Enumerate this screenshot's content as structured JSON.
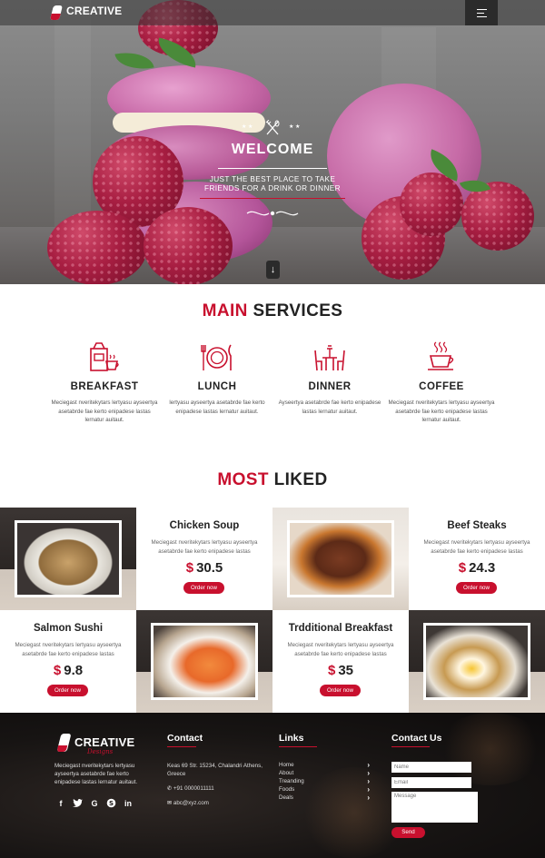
{
  "header": {
    "logo_text": "CREATIVE",
    "menu_icon": "hamburger-icon"
  },
  "hero": {
    "title": "WELCOME",
    "subtitle": "JUST THE BEST PLACE TO TAKE FRIENDS FOR A DRINK OR DINNER",
    "deco_icon": "fork-knife-icon",
    "scroll_icon": "arrow-down-icon"
  },
  "services": {
    "title_accent": "MAIN",
    "title_rest": "SERVICES",
    "items": [
      {
        "label": "BREAKFAST",
        "icon": "breakfast-icon",
        "text": "Meciegast nveritekytars lertyasu ayseertya asetabrde fae kerto enipadese lastas lernatur auitaut."
      },
      {
        "label": "LUNCH",
        "icon": "plate-cutlery-icon",
        "text": "lertyasu ayseertya asetabrde fae kerto enipadese lastas lernatur auitaut."
      },
      {
        "label": "DINNER",
        "icon": "dinner-table-icon",
        "text": "Ayseertya asetabrde fae kerto enipadese lastas lernatur auitaut."
      },
      {
        "label": "COFFEE",
        "icon": "coffee-cup-icon",
        "text": "Meciegast nveritekytars lertyasu ayseertya asetabrde fae kerto enipadese lastas lernatur auitaut."
      }
    ]
  },
  "most_liked": {
    "title_accent": "MOST",
    "title_rest": "LIKED",
    "order_label": "Order now",
    "dishes": [
      {
        "name": "Chicken Soup",
        "text": "Meciegast nveritekytars lertyasu ayseertya asetabrde fae kerto enipadese lastas",
        "currency": "$",
        "price": "30.5"
      },
      {
        "name": "Beef Steaks",
        "text": "Meciegast nveritekytars lertyasu ayseertya asetabrde fae kerto enipadese lastas",
        "currency": "$",
        "price": "24.3"
      },
      {
        "name": "Salmon Sushi",
        "text": "Meciegast nveritekytars lertyasu ayseertya asetabrde fae kerto enipadese lastas",
        "currency": "$",
        "price": "9.8"
      },
      {
        "name": "Trdditional Breakfast",
        "text": "Meciegast nveritekytars lertyasu ayseertya asetabrde fae kerto enipadese lastas",
        "currency": "$",
        "price": "35"
      }
    ]
  },
  "footer": {
    "logo_text": "CREATIVE",
    "logo_sub": "Designs",
    "about": "Meciegast nveritekytars lertyasu ayseertya asetabrde fae kerto enipadese lastas lernatur auitaut.",
    "social_icons": [
      "facebook-icon",
      "twitter-icon",
      "google-icon",
      "skype-icon",
      "linkedin-icon"
    ],
    "contact_title": "Contact",
    "address": "Keas 69 Str. 15234, Chalandri Athens, Greece",
    "phone": "+91 0000011111",
    "email": "abc@xyz.com",
    "links_title": "Links",
    "links": [
      "Home",
      "About",
      "Treanding",
      "Foods",
      "Deals"
    ],
    "contact_us_title": "Contact Us",
    "name_placeholder": "Name",
    "email_placeholder": "Email",
    "message_placeholder": "Message",
    "send_label": "Send"
  },
  "colors": {
    "accent": "#c8102e",
    "dark": "#222222",
    "footer_bg": "#171413"
  }
}
